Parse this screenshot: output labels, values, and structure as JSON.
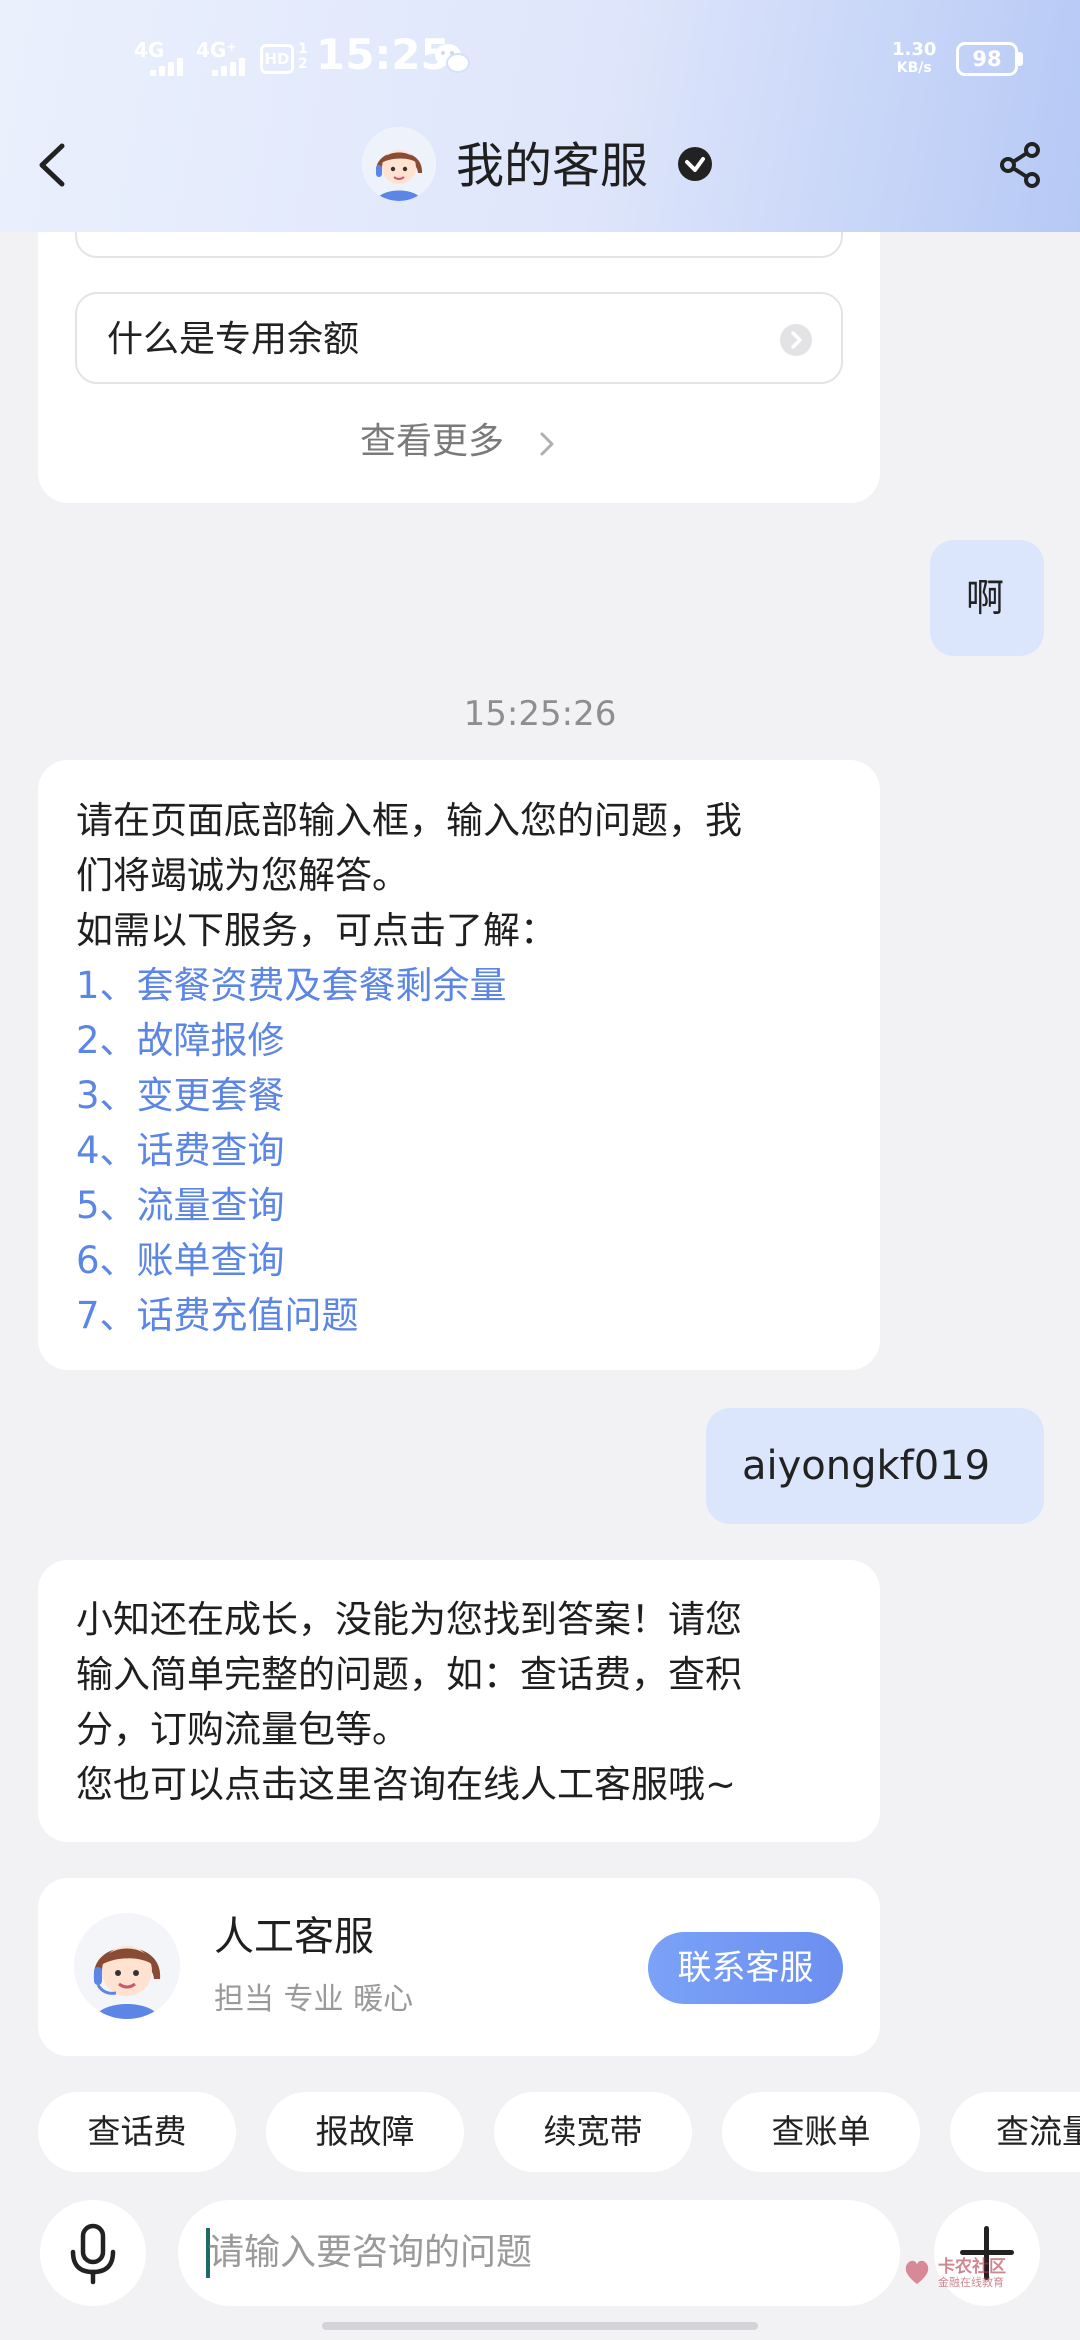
{
  "status_bar": {
    "sig1": "4G",
    "sig2": "4G⁺",
    "hd": "HD",
    "hd_sub": "1\n2",
    "time": "15:25",
    "net_speed_value": "1.30",
    "net_speed_unit": "KB/s",
    "battery": "98"
  },
  "header": {
    "title": "我的客服",
    "icons": {
      "back": "chevron-left-icon",
      "verified": "check-circle-icon",
      "share": "share-icon"
    }
  },
  "faq_card": {
    "items": [
      {
        "label": "什么是专用余额"
      }
    ],
    "see_more": "查看更多"
  },
  "messages": {
    "user_1": "啊",
    "timestamp": "15:25:26",
    "bot_1": {
      "lines": [
        "请在页面底部输入框，输入您的问题，我",
        "们将竭诚为您解答。",
        "如需以下服务，可点击了解："
      ],
      "menu": [
        "1、套餐资费及套餐剩余量",
        "2、故障报修",
        "3、变更套餐",
        "4、话费查询",
        "5、流量查询",
        "6、账单查询",
        "7、话费充值问题"
      ]
    },
    "user_2": "aiyongkf019",
    "bot_2": {
      "lines": [
        "小知还在成长，没能为您找到答案！请您",
        "输入简单完整的问题，如：查话费，查积",
        "分，订购流量包等。",
        "您也可以点击这里咨询在线人工客服哦~"
      ]
    }
  },
  "agent_card": {
    "name": "人工客服",
    "tags": "担当 专业 暖心",
    "button": "联系客服"
  },
  "quick_chips": [
    "查话费",
    "报故障",
    "续宽带",
    "查账单",
    "查流量"
  ],
  "input_bar": {
    "placeholder": "请输入要咨询的问题",
    "icons": {
      "mic": "microphone-icon",
      "plus": "plus-icon"
    }
  },
  "watermark": {
    "text": "卡农社区",
    "sub": "金融在线教育"
  },
  "colors": {
    "accent": "#6c8ff0",
    "link": "#5b86e5",
    "user_bubble": "#dbe6fd",
    "background": "#f2f2f4"
  }
}
